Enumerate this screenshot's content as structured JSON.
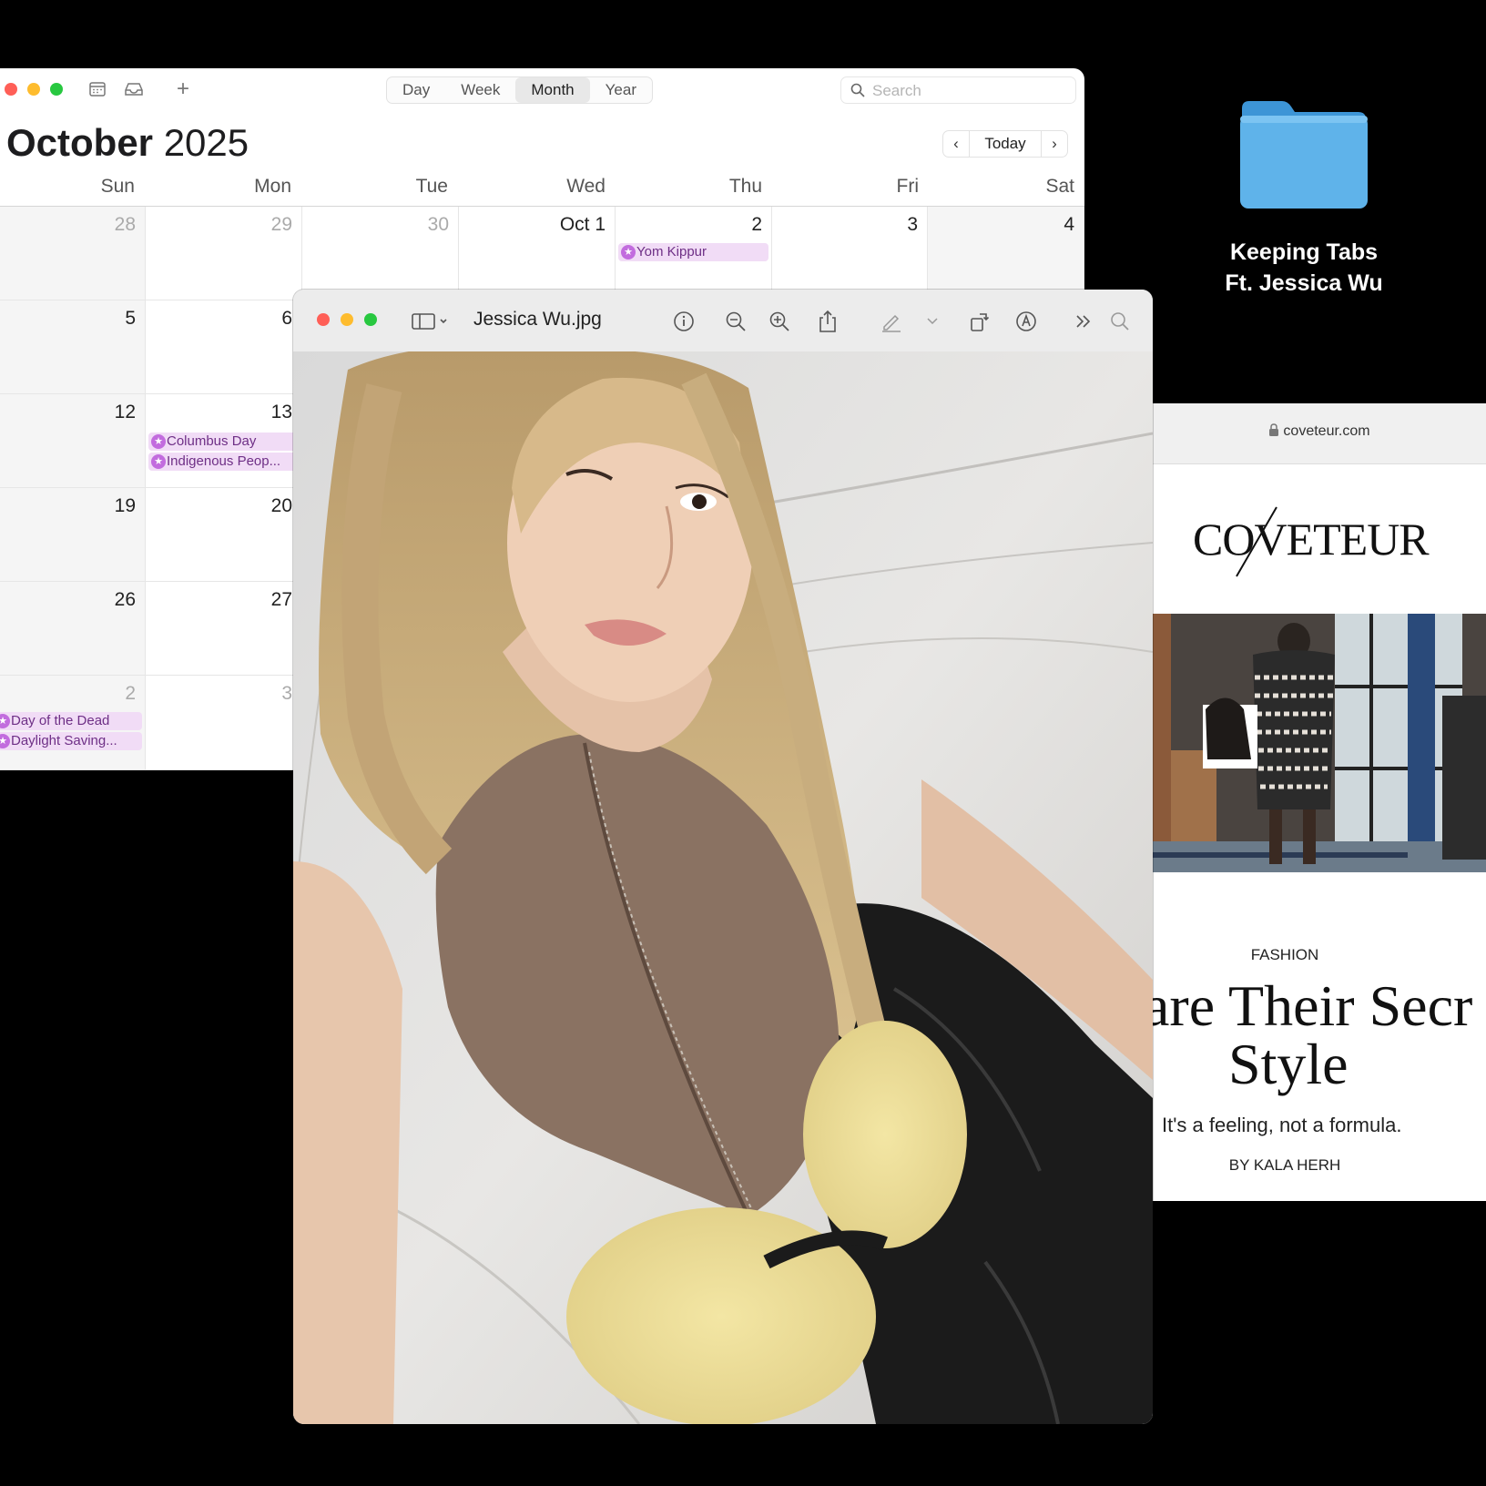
{
  "calendar": {
    "toolbar": {
      "views": [
        "Day",
        "Week",
        "Month",
        "Year"
      ],
      "active_view": "Month",
      "search_placeholder": "Search",
      "add_label": "+"
    },
    "title_month": "October",
    "title_year": "2025",
    "nav": {
      "prev": "‹",
      "today": "Today",
      "next": "›"
    },
    "weekdays": [
      "Sun",
      "Mon",
      "Tue",
      "Wed",
      "Thu",
      "Fri",
      "Sat"
    ],
    "weeks": [
      [
        "28",
        "29",
        "30",
        "Oct 1",
        "2",
        "3",
        "4"
      ],
      [
        "5",
        "6",
        "",
        "",
        "",
        "",
        ""
      ],
      [
        "12",
        "13",
        "",
        "",
        "",
        "",
        ""
      ],
      [
        "19",
        "20",
        "",
        "",
        "",
        "",
        ""
      ],
      [
        "26",
        "27",
        "",
        "",
        "",
        "",
        ""
      ],
      [
        "2",
        "3",
        "",
        "",
        "",
        "",
        ""
      ]
    ],
    "events": {
      "yom_kippur": "Yom Kippur",
      "columbus": "Columbus Day",
      "indigenous": "Indigenous Peop...",
      "dead": "Day of the Dead",
      "dst": "Daylight Saving..."
    }
  },
  "preview": {
    "filename": "Jessica Wu.jpg"
  },
  "folder": {
    "line1": "Keeping Tabs",
    "line2": "Ft. Jessica Wu",
    "color": "#5fb3ea"
  },
  "browser": {
    "url": "coveteur.com",
    "logo": "COVETEUR",
    "category": "FASHION",
    "headline_1": "are Their Secr",
    "headline_2": "Style",
    "subhead": "It's a feeling, not a formula.",
    "byline": "BY KALA HERH"
  }
}
